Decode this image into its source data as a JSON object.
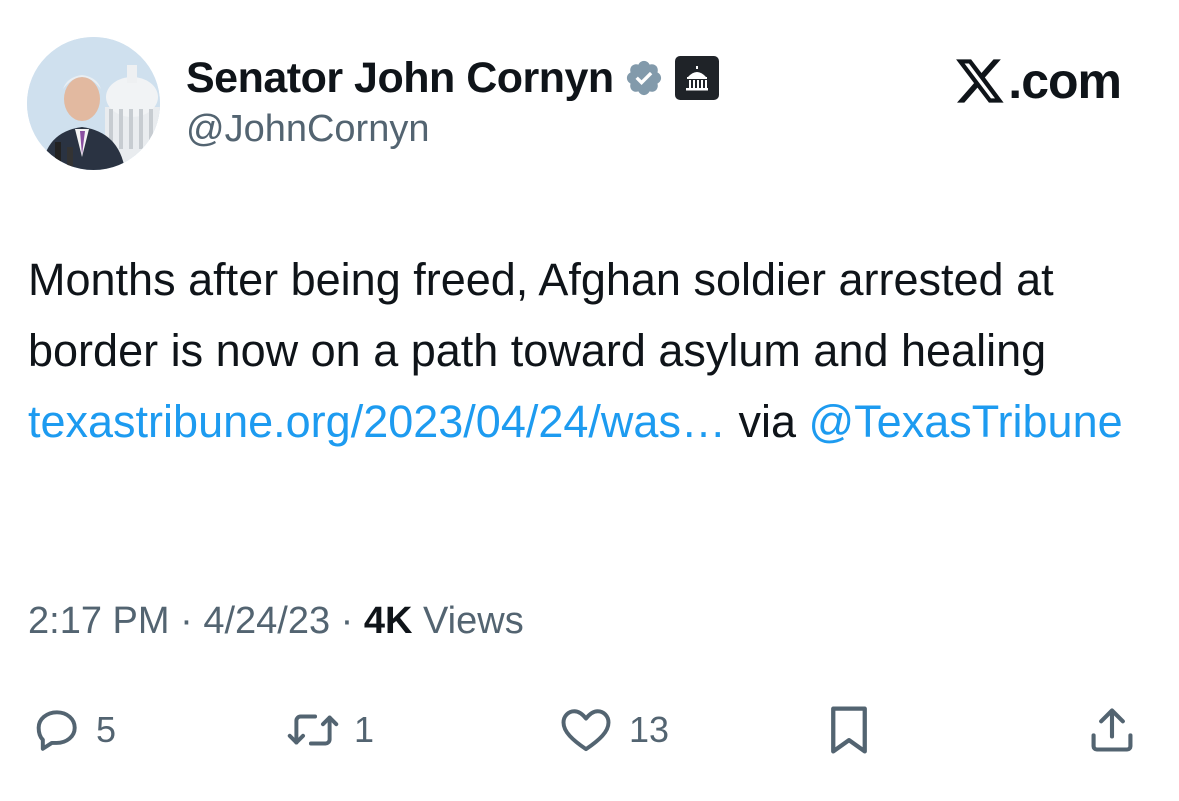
{
  "author": {
    "display_name": "Senator John Cornyn",
    "handle": "@JohnCornyn",
    "avatar_icon": "avatar-photo",
    "verified_color": "#829aab",
    "badge_icon": "capitol-building-icon"
  },
  "brand": {
    "logo_text": ".com"
  },
  "tweet": {
    "text_part1": "Months after being freed, Afghan soldier arrested at border is now on a path toward asylum and healing ",
    "link_url": "texastribune.org/2023/04/24/was…",
    "text_part2": " via ",
    "mention": "@TexasTribune"
  },
  "meta": {
    "time": "2:17 PM",
    "separator": " · ",
    "date": "4/24/23",
    "views_count": "4K",
    "views_label": " Views"
  },
  "actions": {
    "reply_count": "5",
    "repost_count": "1",
    "like_count": "13"
  },
  "colors": {
    "text": "#0f1419",
    "secondary": "#536471",
    "link": "#1d9bf0"
  }
}
